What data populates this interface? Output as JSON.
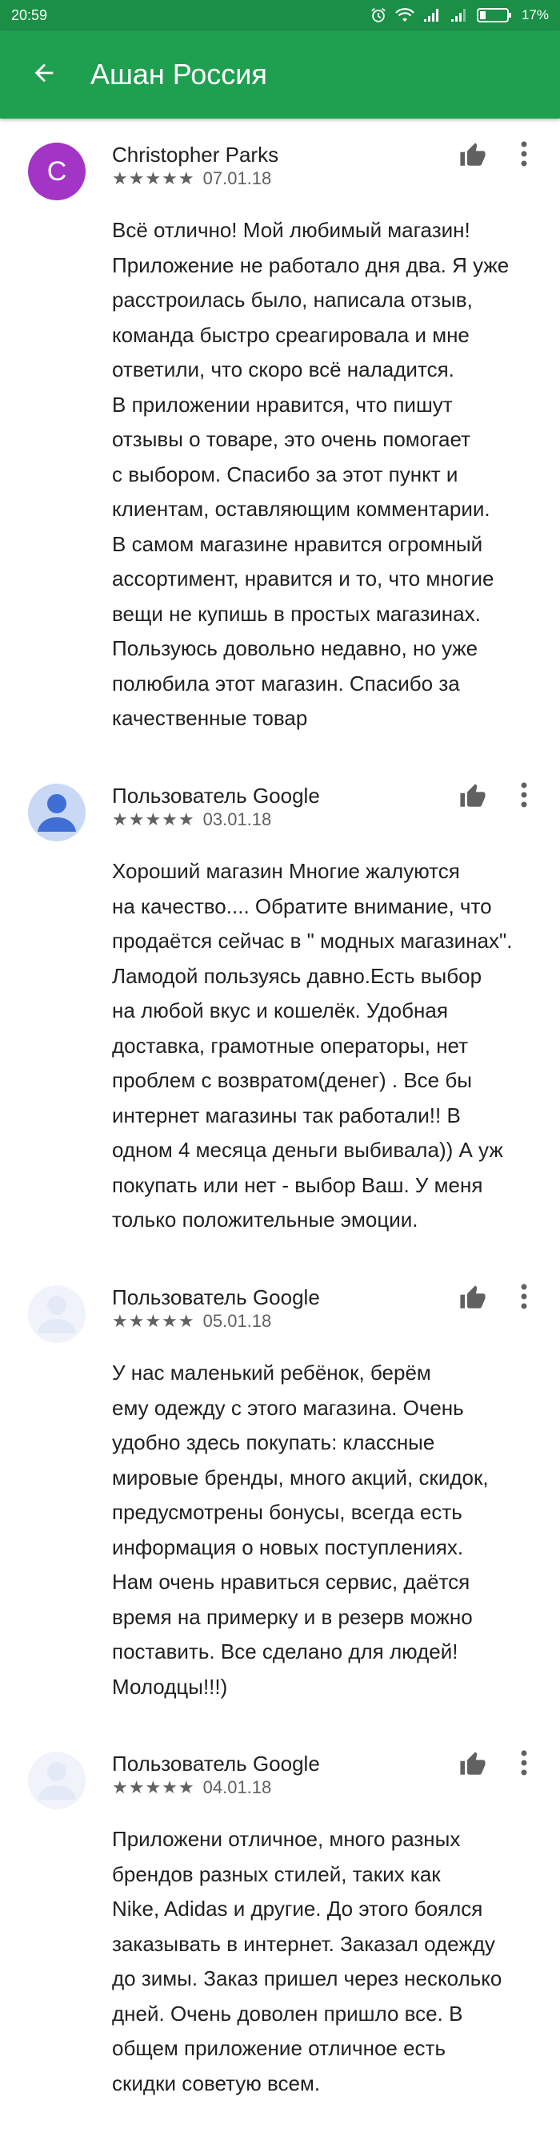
{
  "status_bar": {
    "time": "20:59",
    "battery": "17%"
  },
  "app_bar": {
    "title": "Ашан Россия",
    "back_icon": "arrow-back-icon"
  },
  "reviews": [
    {
      "avatar_letter": "C",
      "author": "Christopher Parks",
      "stars": "★★★★★",
      "date": "07.01.18",
      "text": "Всё отлично! Мой любимый магазин!\nПриложение не работало дня два. Я уже\nрасстроилась было, написала отзыв,\nкоманда быстро среагировала и мне\nответили, что скоро всё наладится.\nВ приложении нравится, что пишут\nотзывы о товаре, это очень помогает\nс выбором. Спасибо за этот пункт и\nклиентам, оставляющим комментарии.\nВ самом магазине нравится огромный\nассортимент, нравится и то, что многие\nвещи не купишь в простых магазинах.\nПользуюсь довольно недавно, но уже\nполюбила этот магазин. Спасибо за\nкачественные товар"
    },
    {
      "author": "Пользователь Google",
      "stars": "★★★★★",
      "date": "03.01.18",
      "text": "Хороший магазин Многие жалуются\nна качество.... Обратите внимание, что\nпродаётся сейчас в \" модных магазинах\".\nЛамодой пользуясь давно.Есть выбор\nна любой вкус и кошелёк. Удобная\nдоставка, грамотные операторы, нет\nпроблем с возвратом(денег) . Все бы\nинтернет магазины так работали!! В\nодном 4 месяца деньги выбивала)) А уж\nпокупать или нет - выбор Ваш. У меня\nтолько положительные эмоции."
    },
    {
      "author": "Пользователь Google",
      "stars": "★★★★★",
      "date": "05.01.18",
      "text": "У нас маленький ребёнок, берём\nему одежду с этого магазина. Очень\nудобно здесь покупать: классные\nмировые бренды, много акций, скидок,\nпредусмотрены бонусы, всегда есть\nинформация о новых поступлениях.\nНам очень нравиться сервис, даётся\nвремя на примерку и в резерв можно\nпоставить. Все сделано для людей!\nМолодцы!!!)"
    },
    {
      "author": "Пользователь Google",
      "stars": "★★★★★",
      "date": "04.01.18",
      "text": "Приложени отличное, много разных\nбрендов разных стилей, таких как\nNike, Adidas и другие. До этого боялся\nзаказывать в интернет. Заказал одежду\nдо зимы. Заказ пришел через несколько\nдней. Очень доволен пришло все. В\nобщем приложение отличное есть\nскидки советую всем."
    }
  ]
}
